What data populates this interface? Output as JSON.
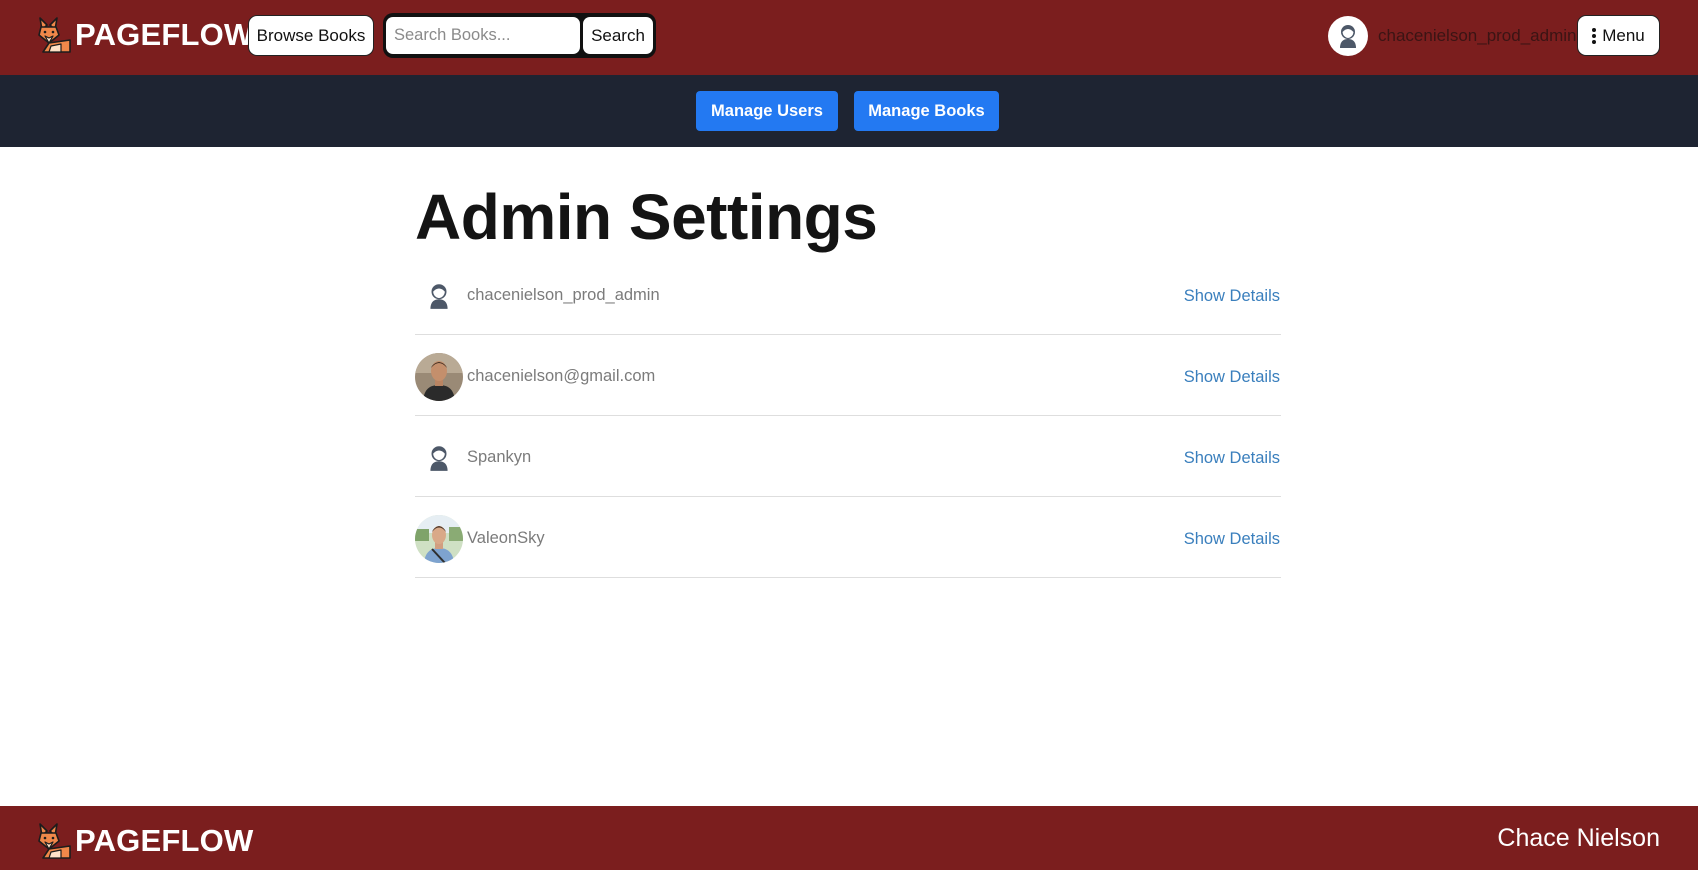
{
  "header": {
    "brand": "PAGEFLOW",
    "browse_label": "Browse Books",
    "search": {
      "placeholder": "Search Books...",
      "button_label": "Search"
    },
    "username": "chacenielson_prod_admin",
    "menu_label": "Menu"
  },
  "admin_nav": {
    "manage_users": "Manage Users",
    "manage_books": "Manage Books"
  },
  "page": {
    "title": "Admin Settings"
  },
  "users": [
    {
      "name": "chacenielson_prod_admin",
      "avatar": "default-avatar-icon",
      "link": "Show Details"
    },
    {
      "name": "chacenielson@gmail.com",
      "avatar": "user-photo",
      "link": "Show Details"
    },
    {
      "name": "Spankyn",
      "avatar": "default-avatar-icon",
      "link": "Show Details"
    },
    {
      "name": "ValeonSky",
      "avatar": "user-photo",
      "link": "Show Details"
    }
  ],
  "footer": {
    "brand": "PAGEFLOW",
    "author": "Chace Nielson"
  },
  "colors": {
    "header_bg": "#7b1e1e",
    "admin_bar_bg": "#1e2432",
    "primary_button": "#2379f2",
    "link": "#3a7fbd"
  }
}
